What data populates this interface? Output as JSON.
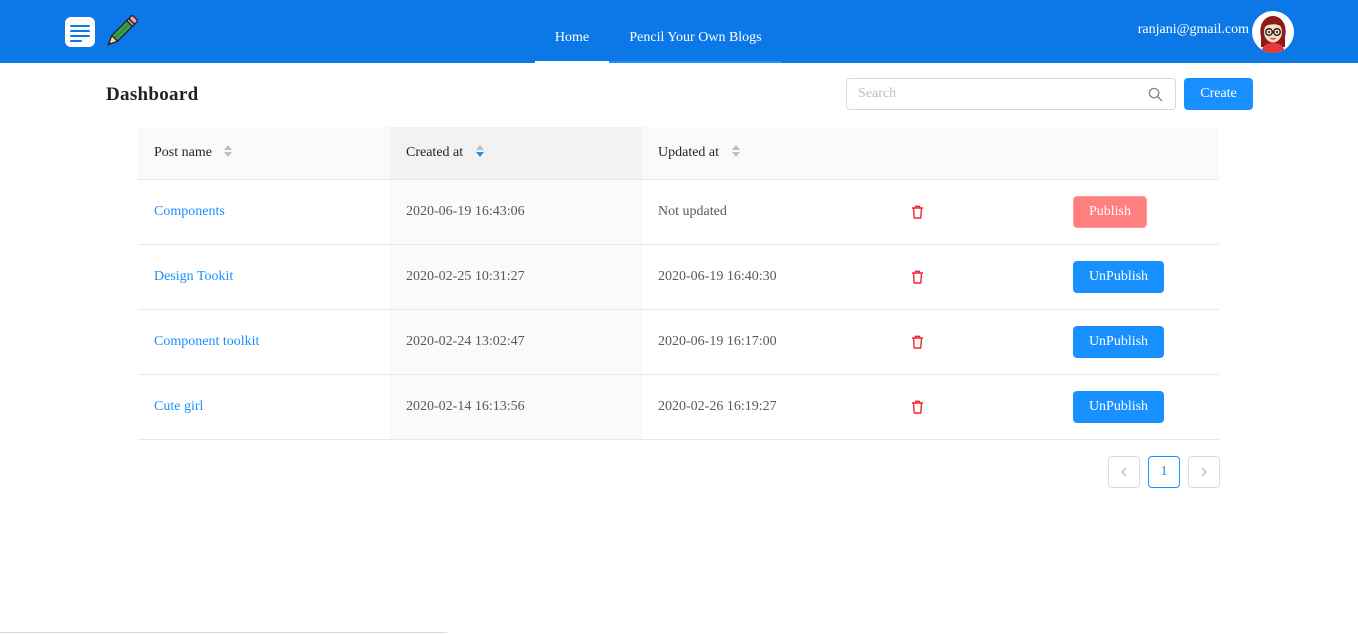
{
  "header": {
    "nav": [
      {
        "label": "Home"
      },
      {
        "label": "Pencil Your Own Blogs"
      }
    ],
    "user_email": "ranjani@gmail.com",
    "brand_color": "#0c78e8"
  },
  "toolbar": {
    "title": "Dashboard",
    "search_placeholder": "Search",
    "create_label": "Create"
  },
  "table": {
    "columns": [
      {
        "label": "Post name",
        "sort": "none"
      },
      {
        "label": "Created at",
        "sort": "descending"
      },
      {
        "label": "Updated at",
        "sort": "none"
      }
    ],
    "rows": [
      {
        "name": "Components",
        "created": "2020-06-19 16:43:06",
        "updated": "Not updated",
        "action": "Publish"
      },
      {
        "name": "Design Tookit",
        "created": "2020-02-25 10:31:27",
        "updated": "2020-06-19 16:40:30",
        "action": "UnPublish"
      },
      {
        "name": "Component toolkit",
        "created": "2020-02-24 13:02:47",
        "updated": "2020-06-19 16:17:00",
        "action": "UnPublish"
      },
      {
        "name": "Cute girl",
        "created": "2020-02-14 16:13:56",
        "updated": "2020-02-26 16:19:27",
        "action": "UnPublish"
      }
    ]
  },
  "pagination": {
    "current_page": "1"
  },
  "icons": {
    "logo": "document-icon",
    "logo_pencil": "pencil-icon",
    "search": "search-icon",
    "delete": "trash-icon",
    "prev": "chevron-left-icon",
    "next": "chevron-right-icon"
  },
  "colors": {
    "primary": "#1890ff",
    "publish_button": "#ff7f7f",
    "delete_icon": "#f5222d"
  }
}
